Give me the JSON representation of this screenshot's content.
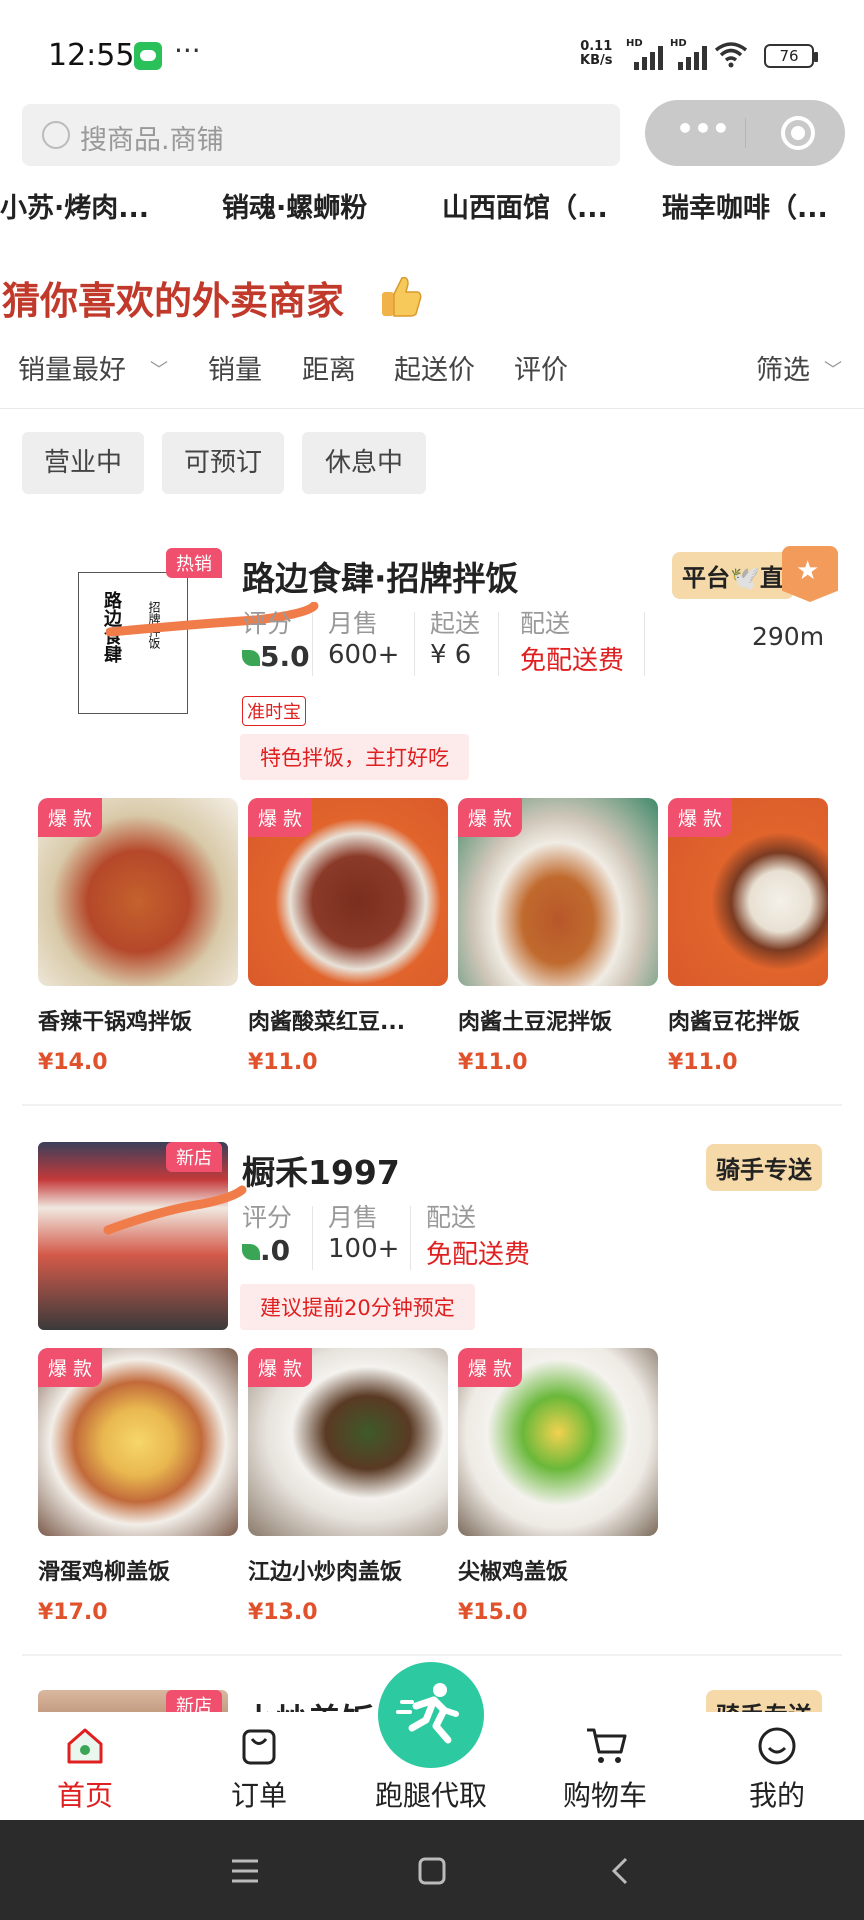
{
  "status_bar": {
    "time": "12:55",
    "dots": "···",
    "net_speed_value": "0.11",
    "net_speed_unit": "KB/s",
    "hd1": "HD",
    "hd2": "HD",
    "battery": "76"
  },
  "search": {
    "placeholder": "搜商品.商铺"
  },
  "recent_shops": [
    "小苏·烤肉...",
    "销魂·螺蛳粉",
    "山西面馆（...",
    "瑞幸咖啡（..."
  ],
  "section_title": "猜你喜欢的外卖商家",
  "sort": {
    "best": "销量最好",
    "sales": "销量",
    "distance": "距离",
    "min_order": "起送价",
    "rating": "评价",
    "filter": "筛选"
  },
  "chips": [
    "营业中",
    "可预订",
    "休息中"
  ],
  "shops": [
    {
      "badge": "热销",
      "name": "路边食肆·招牌拌饭",
      "logo_text_left": "路边食肆",
      "logo_text_right": "招牌拌饭",
      "rating_label": "评分",
      "rating": "5.0",
      "sales_label": "月售",
      "sales": "600+",
      "min_label": "起送",
      "min": "¥ 6",
      "delivery_label": "配送",
      "delivery": "免配送费",
      "delivery_tag": "平台🕊️直",
      "distance": "290m",
      "punctual": "准时宝",
      "slogan": "特色拌饭，主打好吃",
      "dishes": [
        {
          "tag": "爆 款",
          "name": "香辣干锅鸡拌饭",
          "price": "¥14.0"
        },
        {
          "tag": "爆 款",
          "name": "肉酱酸菜红豆...",
          "price": "¥11.0"
        },
        {
          "tag": "爆 款",
          "name": "肉酱土豆泥拌饭",
          "price": "¥11.0"
        },
        {
          "tag": "爆 款",
          "name": "肉酱豆花拌饭",
          "price": "¥11.0"
        }
      ]
    },
    {
      "badge": "新店",
      "name": "橱禾1997",
      "rating_label": "评分",
      "rating": ".0",
      "sales_label": "月售",
      "sales": "100+",
      "delivery_label": "配送",
      "delivery": "免配送费",
      "delivery_tag": "骑手专送",
      "slogan": "建议提前20分钟预定",
      "dishes": [
        {
          "tag": "爆 款",
          "name": "滑蛋鸡柳盖饭",
          "price": "¥17.0"
        },
        {
          "tag": "爆 款",
          "name": "江边小炒肉盖饭",
          "price": "¥13.0"
        },
        {
          "tag": "爆 款",
          "name": "尖椒鸡盖饭",
          "price": "¥15.0"
        }
      ]
    },
    {
      "badge": "新店",
      "name": "小炒盖饭",
      "delivery_tag": "骑手专送"
    }
  ],
  "tabbar": {
    "home": "首页",
    "orders": "订单",
    "errand": "跑腿代取",
    "cart": "购物车",
    "mine": "我的"
  },
  "colors": {
    "accent_red": "#e02020",
    "title_red": "#c0392b",
    "price_orange": "#e0522b",
    "errand_green": "#2dc9a0",
    "tag_gold": "#f5d9a8"
  }
}
